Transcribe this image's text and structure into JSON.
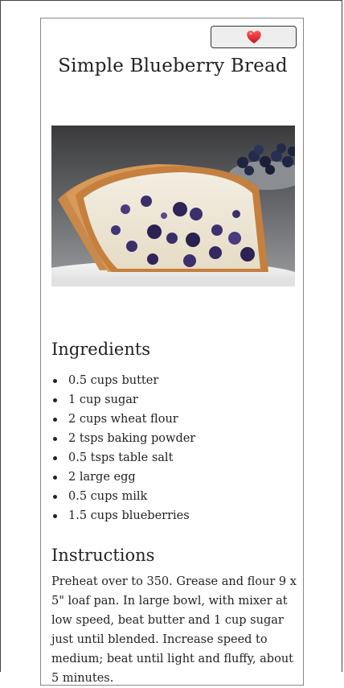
{
  "recipe": {
    "title": "Simple Blueberry Bread",
    "favorite_icon": "heart-icon",
    "image_alt": "Blueberry bread",
    "ingredients_heading": "Ingredients",
    "ingredients": [
      "0.5 cups butter",
      "1 cup sugar",
      "2 cups wheat flour",
      "2 tsps baking powder",
      "0.5 tsps table salt",
      "2 large egg",
      "0.5 cups milk",
      "1.5 cups blueberries"
    ],
    "instructions_heading": "Instructions",
    "instructions": "Preheat over to 350. Grease and flour 9 x 5\" loaf pan. In large bowl, with mixer at low speed, beat butter and 1 cup sugar just until blended. Increase speed to medium; beat until light and fluffy, about 5 minutes."
  },
  "colors": {
    "heart": "#e0202a",
    "button_bg": "#eeeeee",
    "text": "#222222"
  }
}
